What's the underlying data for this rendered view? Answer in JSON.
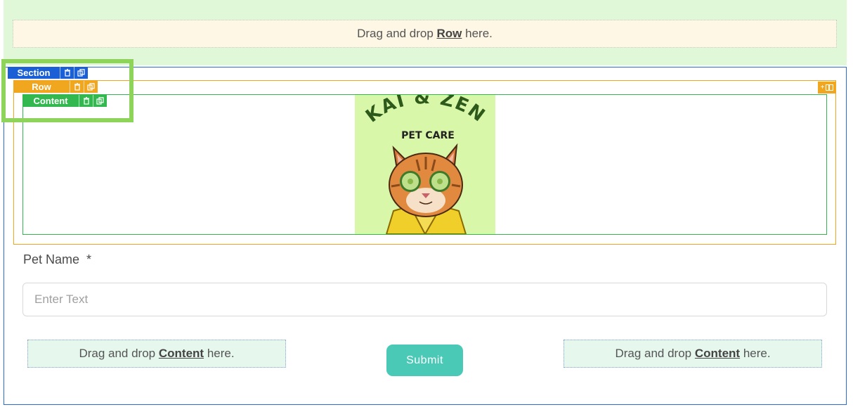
{
  "canvas": {
    "row_drop": {
      "prefix": "Drag and drop ",
      "keyword": "Row",
      "suffix": " here."
    }
  },
  "tags": {
    "section": "Section",
    "row": "Row",
    "content": "Content"
  },
  "logo": {
    "line1": "KAI & ZEN",
    "line2": "PET CARE"
  },
  "form": {
    "pet_name_label": "Pet Name",
    "required_mark": "*",
    "pet_name_placeholder": "Enter Text",
    "submit_label": "Submit"
  },
  "content_drop_left": {
    "prefix": "Drag and drop ",
    "keyword": "Content",
    "suffix": " here."
  },
  "content_drop_right": {
    "prefix": "Drag and drop ",
    "keyword": "Content",
    "suffix": " here."
  },
  "icons": {
    "delete": "trash-icon",
    "duplicate": "copy-icon",
    "add_column": "plus-icon",
    "layout": "columns-icon"
  },
  "colors": {
    "section": "#1a5fd6",
    "row": "#f0a61f",
    "content": "#33b850",
    "highlight": "#8fd45a",
    "submit": "#4ac9b7"
  }
}
